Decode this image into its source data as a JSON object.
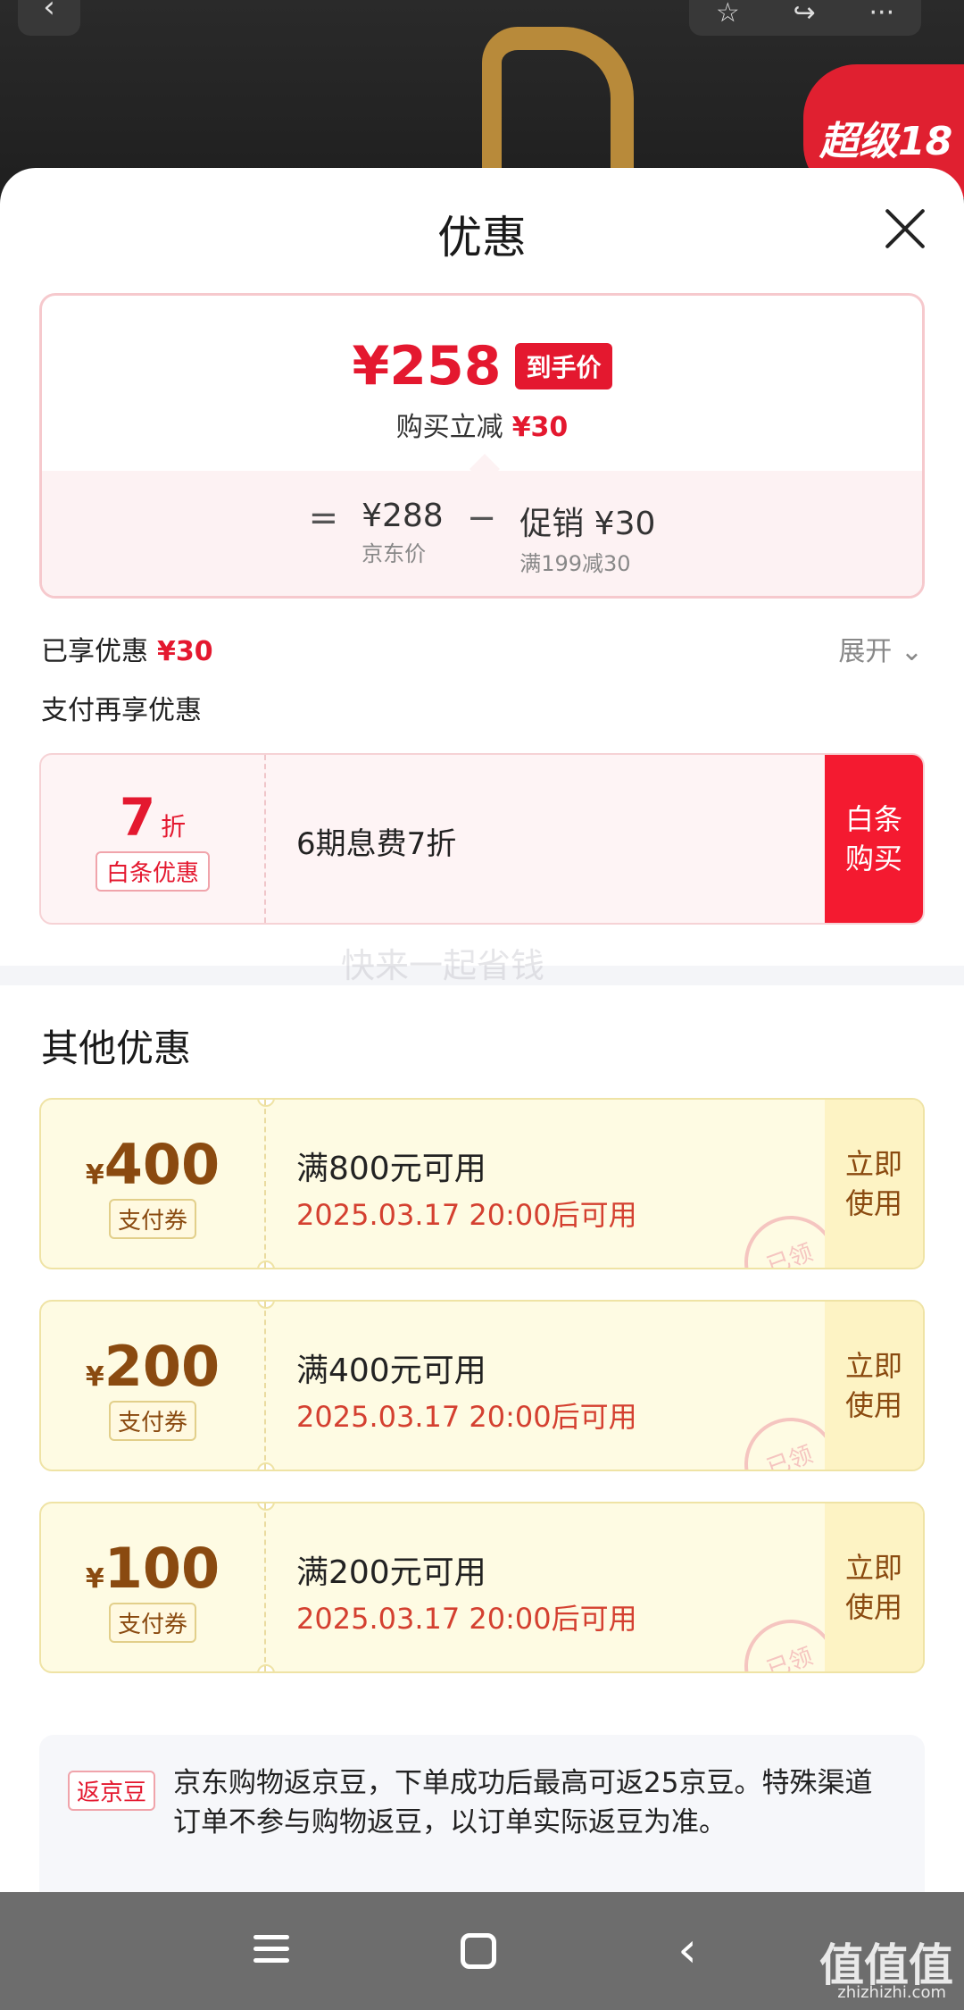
{
  "background": {
    "promo_badge": "超级18"
  },
  "sheet": {
    "title": "优惠"
  },
  "price": {
    "final_price": "¥258",
    "final_tag": "到手价",
    "instant_reduction_label": "购买立减",
    "instant_reduction_value": "¥30",
    "eq_sign": "=",
    "jd_price": "¥288",
    "jd_price_label": "京东价",
    "minus_sign": "−",
    "promo_value": "促销 ¥30",
    "promo_desc": "满199减30"
  },
  "enjoyed": {
    "label": "已享优惠",
    "value": "¥30",
    "expand": "展开"
  },
  "pay_again_label": "支付再享优惠",
  "baitiao": {
    "discount": "7",
    "discount_unit": "折",
    "tag": "白条优惠",
    "desc": "6期息费7折",
    "button": "白条\n购买"
  },
  "watermark": "快来一起省钱",
  "other_title": "其他优惠",
  "coupons": [
    {
      "amount": "400",
      "tag": "支付券",
      "condition": "满800元可用",
      "time": "2025.03.17 20:00后可用",
      "button": "立即\n使用",
      "stamp": "已领"
    },
    {
      "amount": "200",
      "tag": "支付券",
      "condition": "满400元可用",
      "time": "2025.03.17 20:00后可用",
      "button": "立即\n使用",
      "stamp": "已领"
    },
    {
      "amount": "100",
      "tag": "支付券",
      "condition": "满200元可用",
      "time": "2025.03.17 20:00后可用",
      "button": "立即\n使用",
      "stamp": "已领"
    }
  ],
  "jd_beans": {
    "tag": "返京豆",
    "text": "京东购物返京豆，下单成功后最高可返25京豆。特殊渠道订单不参与购物返豆，以订单实际返豆为准。"
  },
  "brand": {
    "name": "值值值",
    "url": "zhizhizhi.com"
  }
}
